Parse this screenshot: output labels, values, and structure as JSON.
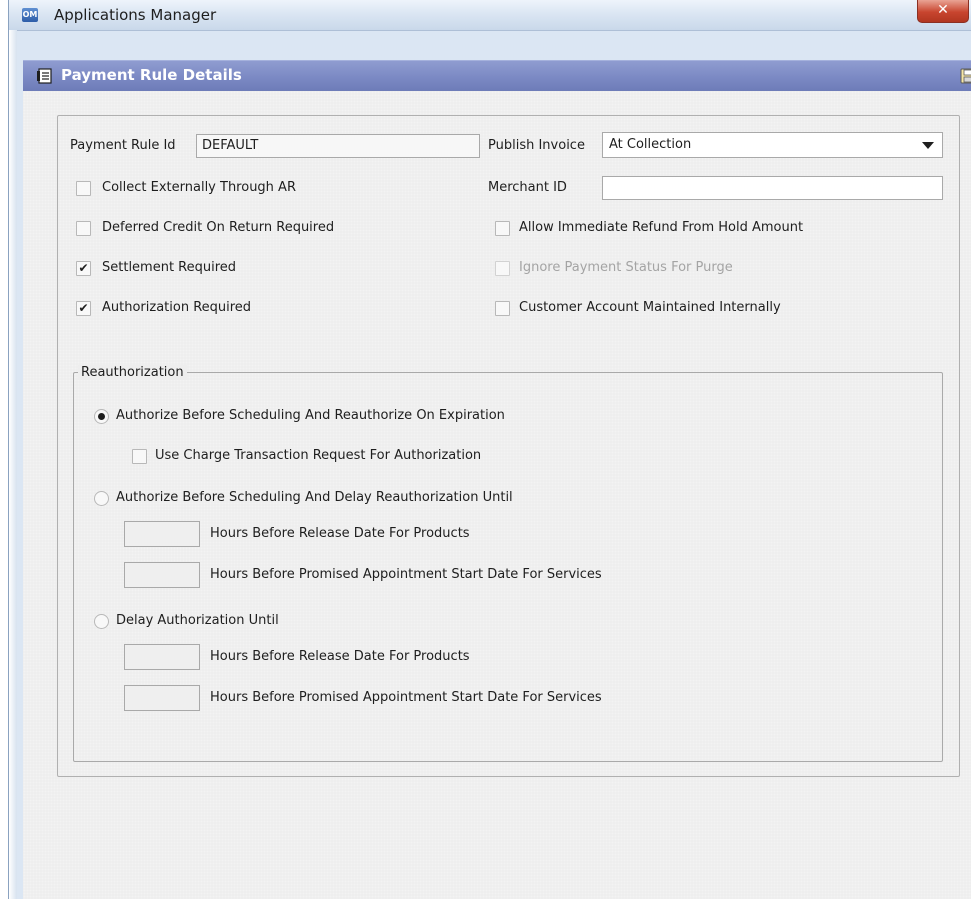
{
  "window": {
    "title": "Applications Manager",
    "app_icon_text": "OM",
    "close_label": "✕"
  },
  "panel": {
    "title": "Payment Rule Details",
    "header_icon": "document-list-icon",
    "save_icon": "save-icon"
  },
  "form": {
    "payment_rule_id": {
      "label": "Payment Rule Id",
      "value": "DEFAULT"
    },
    "publish_invoice": {
      "label": "Publish Invoice",
      "value": "At Collection"
    },
    "merchant_id": {
      "label": "Merchant ID",
      "value": ""
    },
    "checkboxes": {
      "collect_externally": {
        "label": "Collect Externally Through AR",
        "checked": false
      },
      "deferred_credit": {
        "label": "Deferred Credit On Return Required",
        "checked": false
      },
      "settlement_required": {
        "label": "Settlement Required",
        "checked": true
      },
      "authorization_required": {
        "label": "Authorization Required",
        "checked": true
      },
      "allow_immediate_refund": {
        "label": "Allow Immediate Refund From Hold Amount",
        "checked": false
      },
      "ignore_payment_status": {
        "label": "Ignore Payment Status For Purge",
        "checked": false,
        "disabled": true
      },
      "customer_account_internal": {
        "label": "Customer Account Maintained Internally",
        "checked": false
      }
    },
    "reauthorization": {
      "legend": "Reauthorization",
      "option1": {
        "label": "Authorize Before Scheduling And Reauthorize On Expiration",
        "selected": true
      },
      "use_charge_transaction": {
        "label": "Use Charge Transaction Request For Authorization",
        "checked": false
      },
      "option2": {
        "label": "Authorize Before Scheduling And Delay Reauthorization Until",
        "selected": false
      },
      "option2_hours_products": {
        "label": "Hours Before Release Date For Products",
        "value": ""
      },
      "option2_hours_services": {
        "label": "Hours Before Promised Appointment Start Date For Services",
        "value": ""
      },
      "option3": {
        "label": "Delay Authorization Until",
        "selected": false
      },
      "option3_hours_products": {
        "label": "Hours Before Release Date For Products",
        "value": ""
      },
      "option3_hours_services": {
        "label": "Hours Before Promised Appointment Start Date For Services",
        "value": ""
      }
    }
  },
  "colors": {
    "header_gradient": "#7d8bc5",
    "window_frame": "#dbe6f3",
    "close_button": "#c8452f"
  }
}
